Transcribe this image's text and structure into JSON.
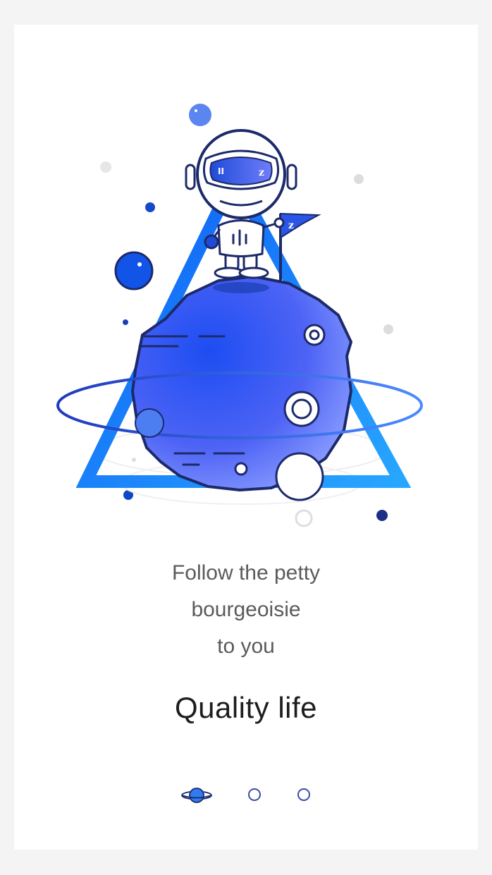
{
  "onboarding": {
    "tagline": [
      "Follow the petty",
      "bourgeoisie",
      "to you"
    ],
    "headline": "Quality life",
    "pager": {
      "current": 1,
      "total": 3
    },
    "flag_letter": "z",
    "visor_text_left": "II",
    "visor_text_right": "z",
    "colors": {
      "primary": "#1f5cf2",
      "accent": "#2b44c7",
      "dark_navy": "#1c2a6b",
      "grey_dot": "#dddddd"
    }
  }
}
